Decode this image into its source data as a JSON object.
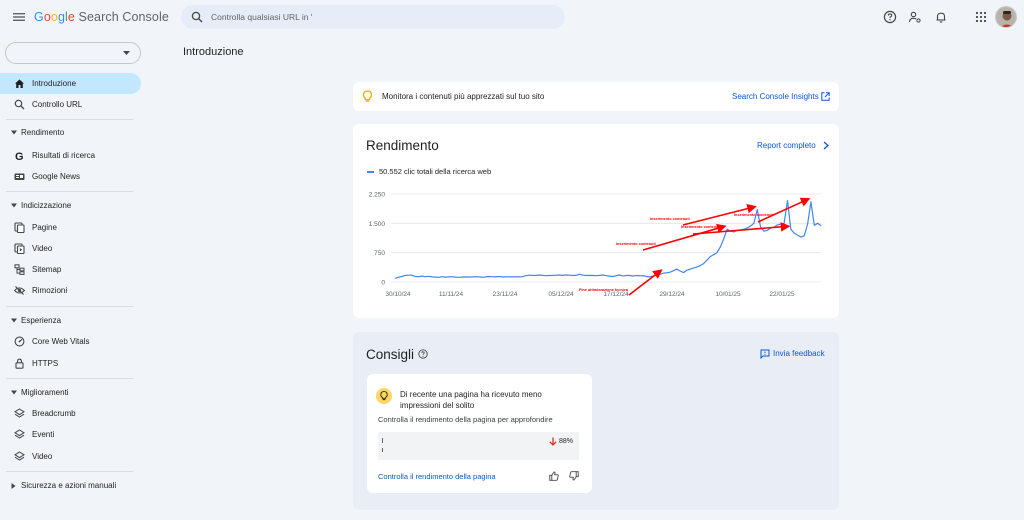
{
  "app": {
    "logo": {
      "g": "G",
      "o1": "o",
      "o2": "o",
      "g2": "g",
      "l": "l",
      "e": "e",
      "suffix": " Search Console"
    },
    "search_placeholder": "Controlla qualsiasi URL in '"
  },
  "sidebar": {
    "property_value": "",
    "items": [
      {
        "label": "Introduzione",
        "icon": "home-icon",
        "active": true
      },
      {
        "label": "Controllo URL",
        "icon": "search-icon",
        "active": false
      }
    ],
    "sections": [
      {
        "label": "Rendimento",
        "items": [
          {
            "label": "Risultati di ricerca",
            "icon": "google-g-icon"
          },
          {
            "label": "Google News",
            "icon": "news-icon"
          }
        ]
      },
      {
        "label": "Indicizzazione",
        "items": [
          {
            "label": "Pagine",
            "icon": "pages-icon"
          },
          {
            "label": "Video",
            "icon": "video-pages-icon"
          },
          {
            "label": "Sitemap",
            "icon": "sitemap-icon"
          },
          {
            "label": "Rimozioni",
            "icon": "removals-icon"
          }
        ]
      },
      {
        "label": "Esperienza",
        "items": [
          {
            "label": "Core Web Vitals",
            "icon": "gauge-icon"
          },
          {
            "label": "HTTPS",
            "icon": "lock-icon"
          }
        ]
      },
      {
        "label": "Miglioramenti",
        "items": [
          {
            "label": "Breadcrumb",
            "icon": "layers-icon"
          },
          {
            "label": "Eventi",
            "icon": "layers-icon"
          },
          {
            "label": "Video",
            "icon": "layers-icon"
          }
        ]
      },
      {
        "label": "Sicurezza e azioni manuali",
        "collapsed": true
      }
    ]
  },
  "page": {
    "title": "Introduzione"
  },
  "insights": {
    "message": "Monitora i contenuti più apprezzati sul tuo sito",
    "link": "Search Console Insights"
  },
  "performance": {
    "title": "Rendimento",
    "full_report": "Report completo",
    "legend": "50.552 clic totali della ricerca web"
  },
  "chart_data": {
    "type": "line",
    "series": [
      {
        "name": "50.552 clic totali della ricerca web",
        "color": "#4285f4",
        "values": [
          95,
          120,
          140,
          165,
          175,
          175,
          140,
          135,
          150,
          135,
          145,
          130,
          125,
          120,
          135,
          125,
          130,
          135,
          125,
          120,
          125,
          130,
          125,
          130,
          135,
          130,
          120,
          130,
          140,
          135,
          130,
          140,
          130,
          130,
          135,
          130,
          135,
          130,
          135,
          160,
          175,
          170,
          165,
          180,
          170,
          160,
          165,
          170,
          175,
          180,
          170,
          180,
          175,
          165,
          170,
          200,
          175,
          165,
          170,
          165,
          160,
          170,
          180,
          160,
          150,
          140,
          160,
          180,
          150,
          170,
          165,
          150,
          170,
          155,
          160,
          140,
          130,
          155,
          190,
          200,
          225,
          235,
          250,
          290,
          330,
          280,
          240,
          300,
          330,
          355,
          380,
          420,
          470,
          560,
          650,
          700,
          750,
          900,
          1100,
          1350,
          1300,
          1280,
          1320,
          1330,
          1350,
          1380,
          1430,
          1500,
          1850,
          1400,
          1300,
          1320,
          1380,
          1400,
          1460,
          1480,
          1500,
          2080,
          1350,
          1250,
          1200,
          1150,
          1180,
          1480,
          2050,
          1450,
          1500,
          1440
        ]
      }
    ],
    "x_tick_labels": [
      "30/10/24",
      "11/11/24",
      "23/11/24",
      "05/12/24",
      "17/12/24",
      "29/12/24",
      "10/01/25",
      "22/01/25"
    ],
    "y_tick_labels": [
      "0",
      "750",
      "1.500",
      "2.250"
    ],
    "ylim": [
      0,
      2250
    ],
    "grid": true,
    "annotations": [
      {
        "text": "Fine ottimizzazione tecnica",
        "color": "#ff0000"
      },
      {
        "text": "Inserimento contenuti",
        "color": "#ff0000"
      },
      {
        "text": "Inserimento contenuti",
        "color": "#ff0000"
      },
      {
        "text": "Inserimento contenuti",
        "color": "#ff0000"
      },
      {
        "text": "Inserimento contenuti",
        "color": "#ff0000"
      }
    ]
  },
  "tips": {
    "title": "Consigli",
    "feedback": "Invia feedback",
    "card": {
      "heading": "Di recente una pagina ha ricevuto meno impressioni del solito",
      "sub": "Controlla il rendimento della pagina per approfondire",
      "pct": "88%",
      "link": "Controlla il rendimento della pagina"
    }
  },
  "colors": {
    "accent": "#0b57d0",
    "active_nav": "#c2e7ff",
    "line": "#4285f4",
    "annotation": "#ff0000"
  }
}
